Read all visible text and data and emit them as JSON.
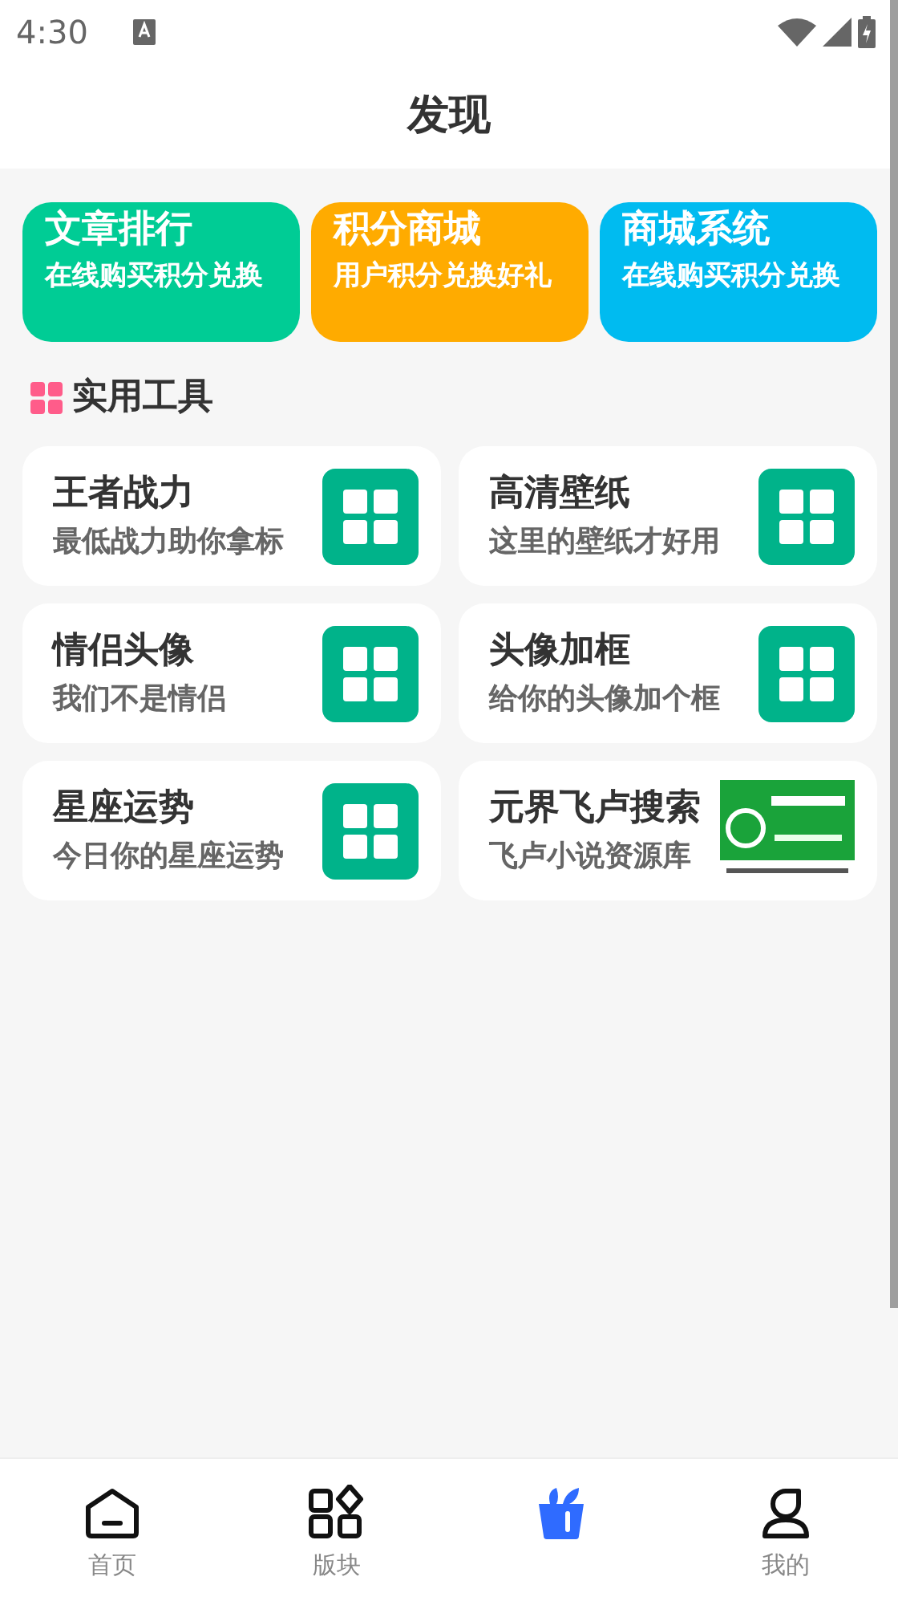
{
  "status_bar": {
    "time": "4:30"
  },
  "header": {
    "title": "发现"
  },
  "feature_cards": [
    {
      "title": "文章排行",
      "subtitle": "在线购买积分兑换",
      "color": "#00cc95"
    },
    {
      "title": "积分商城",
      "subtitle": "用户积分兑换好礼",
      "color": "#ffab00"
    },
    {
      "title": "商城系统",
      "subtitle": "在线购买积分兑换",
      "color": "#00bbf0"
    }
  ],
  "section": {
    "title": "实用工具"
  },
  "tools": [
    {
      "title": "王者战力",
      "subtitle": "最低战力助你拿标",
      "kind": "grid"
    },
    {
      "title": "高清壁纸",
      "subtitle": "这里的壁纸才好用",
      "kind": "grid"
    },
    {
      "title": "情侣头像",
      "subtitle": "我们不是情侣",
      "kind": "grid"
    },
    {
      "title": "头像加框",
      "subtitle": "给你的头像加个框",
      "kind": "grid"
    },
    {
      "title": "星座运势",
      "subtitle": "今日你的星座运势",
      "kind": "grid"
    },
    {
      "title": "元界飞卢搜索",
      "subtitle": "飞卢小说资源库",
      "kind": "picture"
    }
  ],
  "bottom_nav": [
    {
      "label": "首页",
      "kind": "home",
      "selected": false
    },
    {
      "label": "版块",
      "kind": "blocks",
      "selected": false
    },
    {
      "kind": "basket",
      "selected": true
    },
    {
      "label": "我的",
      "kind": "user",
      "selected": false
    }
  ]
}
